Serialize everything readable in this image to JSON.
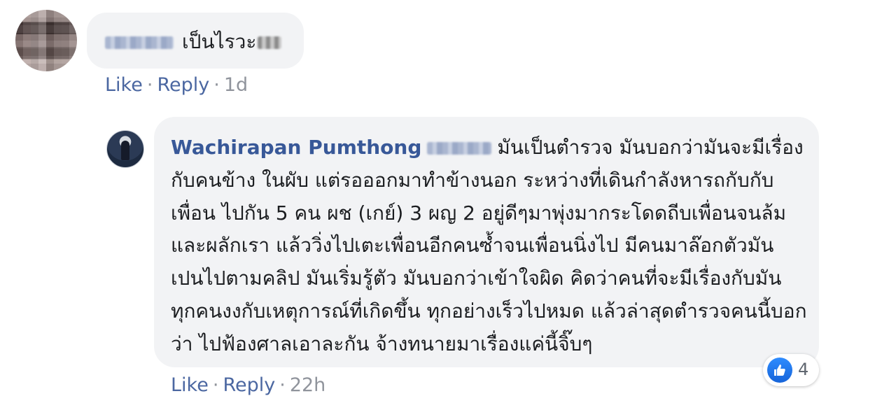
{
  "top_comment": {
    "text": "เป็นไรวะ",
    "actions": {
      "like": "Like",
      "reply": "Reply",
      "time": "1d"
    }
  },
  "reply_comment": {
    "author": "Wachirapan Pumthong",
    "text": "มันเป็นตำรวจ มันบอกว่ามันจะมีเรื่องกับคนข้าง ในผับ แต่รอออกมาทำข้างนอก ระหว่างที่เดินกำลังหารถกับกับเพื่อน ไปกัน 5 คน ผช (เกย์) 3 ผญ 2 อยู่ดีๆมาพุ่งมากระโดดถีบเพื่อนจนล้ม และผลักเรา แล้ววิ่งไปเตะเพื่อนอีกคนซ้ำจนเพื่อนนิ่งไป มีคนมาล๊อกตัวมัน เปนไปตามคลิป มันเริ่มรู้ตัว มันบอกว่าเข้าใจผิด คิดว่าคนที่จะมีเรื่องกับมัน ทุกคนงงกับเหตุการณ์ที่เกิดขึ้น ทุกอย่างเร็วไปหมด แล้วล่าสุดตำรวจคนนี้บอกว่า ไปฟ้องศาลเอาละกัน จ้างทนายมาเรื่องแค่นี้จิ๊บๆ",
    "actions": {
      "like": "Like",
      "reply": "Reply",
      "time": "22h"
    },
    "reaction": {
      "icon": "thumbs-up-icon",
      "count": "4",
      "color": "#1877f2"
    }
  },
  "separator": "·"
}
